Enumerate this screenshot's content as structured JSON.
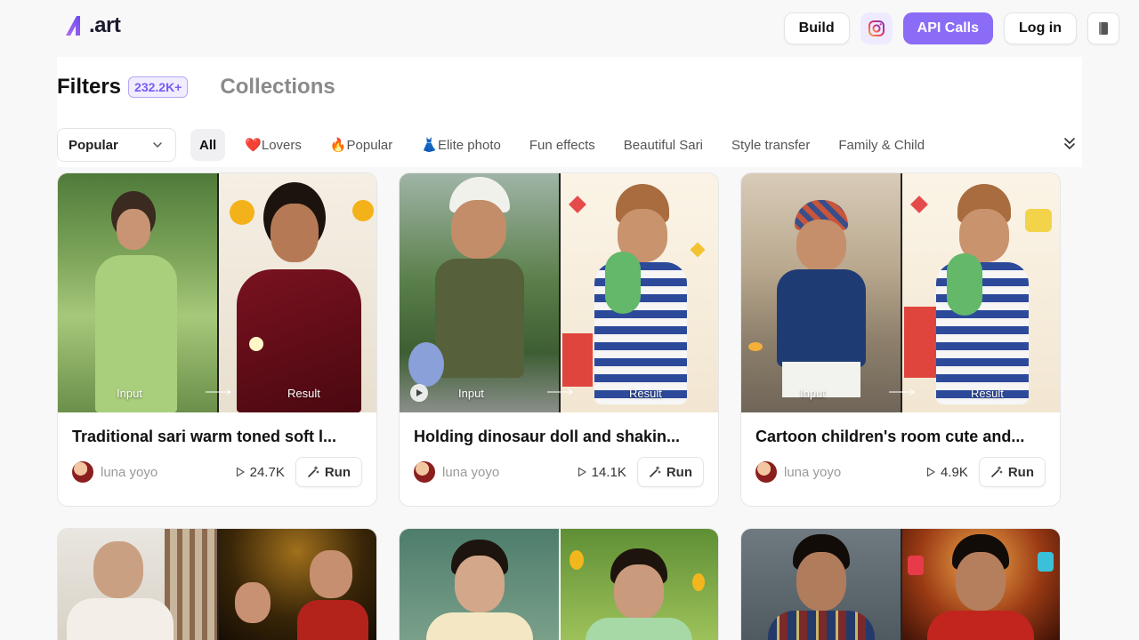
{
  "brand": {
    "logo_text": ".art",
    "accent": "#8b6cf6"
  },
  "nav": {
    "build_label": "Build",
    "instagram_icon": "instagram-icon",
    "api_label": "API Calls",
    "login_label": "Log in",
    "menu_icon": "book-icon"
  },
  "header": {
    "filters_title": "Filters",
    "filters_count": "232.2K+",
    "collections_title": "Collections"
  },
  "filters": {
    "sort_value": "Popular",
    "chips": [
      "All",
      "❤️Lovers",
      "🔥Popular",
      "👗Elite photo",
      "Fun effects",
      "Beautiful Sari",
      "Style transfer",
      "Family & Child"
    ],
    "active_chip": "All"
  },
  "card_labels": {
    "input": "Input",
    "result": "Result",
    "run": "Run"
  },
  "cards": [
    {
      "title": "Traditional sari warm toned soft l...",
      "author": "luna yoyo",
      "views": "24.7K",
      "has_play": false
    },
    {
      "title": "Holding dinosaur doll and shakin...",
      "author": "luna yoyo",
      "views": "14.1K",
      "has_play": true
    },
    {
      "title": "Cartoon children's room cute and...",
      "author": "luna yoyo",
      "views": "4.9K",
      "has_play": false
    }
  ]
}
